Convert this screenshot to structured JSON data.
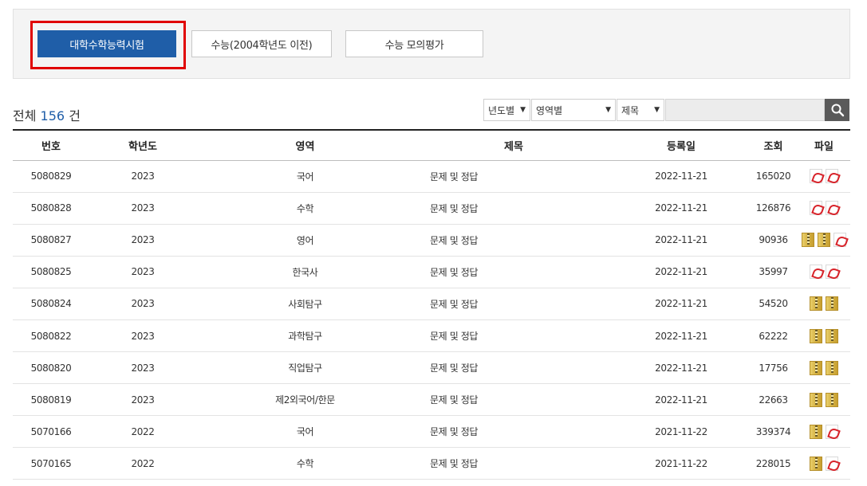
{
  "tabs": [
    {
      "label": "대학수학능력시험",
      "active": true
    },
    {
      "label": "수능(2004학년도 이전)",
      "active": false
    },
    {
      "label": "수능 모의평가",
      "active": false
    }
  ],
  "summary": {
    "prefix": "전체",
    "count": "156",
    "suffix": "건"
  },
  "filters": {
    "year": "년도별",
    "area": "영역별",
    "field": "제목"
  },
  "table": {
    "columns": [
      "번호",
      "학년도",
      "영역",
      "제목",
      "등록일",
      "조회",
      "파일"
    ],
    "rows": [
      {
        "no": "5080829",
        "year": "2023",
        "area": "국어",
        "title": "문제 및 정답",
        "date": "2022-11-21",
        "views": "165020",
        "files": [
          "pdf",
          "pdf"
        ]
      },
      {
        "no": "5080828",
        "year": "2023",
        "area": "수학",
        "title": "문제 및 정답",
        "date": "2022-11-21",
        "views": "126876",
        "files": [
          "pdf",
          "pdf"
        ]
      },
      {
        "no": "5080827",
        "year": "2023",
        "area": "영어",
        "title": "문제 및 정답",
        "date": "2022-11-21",
        "views": "90936",
        "files": [
          "zip",
          "zip",
          "pdf"
        ]
      },
      {
        "no": "5080825",
        "year": "2023",
        "area": "한국사",
        "title": "문제 및 정답",
        "date": "2022-11-21",
        "views": "35997",
        "files": [
          "pdf",
          "pdf"
        ]
      },
      {
        "no": "5080824",
        "year": "2023",
        "area": "사회탐구",
        "title": "문제 및 정답",
        "date": "2022-11-21",
        "views": "54520",
        "files": [
          "zip",
          "zip"
        ]
      },
      {
        "no": "5080822",
        "year": "2023",
        "area": "과학탐구",
        "title": "문제 및 정답",
        "date": "2022-11-21",
        "views": "62222",
        "files": [
          "zip",
          "zip"
        ]
      },
      {
        "no": "5080820",
        "year": "2023",
        "area": "직업탐구",
        "title": "문제 및 정답",
        "date": "2022-11-21",
        "views": "17756",
        "files": [
          "zip",
          "zip"
        ]
      },
      {
        "no": "5080819",
        "year": "2023",
        "area": "제2외국어/한문",
        "title": "문제 및 정답",
        "date": "2022-11-21",
        "views": "22663",
        "files": [
          "zip",
          "zip"
        ]
      },
      {
        "no": "5070166",
        "year": "2022",
        "area": "국어",
        "title": "문제 및 정답",
        "date": "2021-11-22",
        "views": "339374",
        "files": [
          "zip",
          "pdf"
        ]
      },
      {
        "no": "5070165",
        "year": "2022",
        "area": "수학",
        "title": "문제 및 정답",
        "date": "2021-11-22",
        "views": "228015",
        "files": [
          "zip",
          "pdf"
        ]
      }
    ]
  },
  "icons": {
    "search": "search-icon",
    "pdf": "pdf-file-icon",
    "zip": "zip-file-icon",
    "dropdown": "chevron-down-icon"
  },
  "colors": {
    "accent": "#1f5ea8",
    "highlight": "#e00000"
  }
}
